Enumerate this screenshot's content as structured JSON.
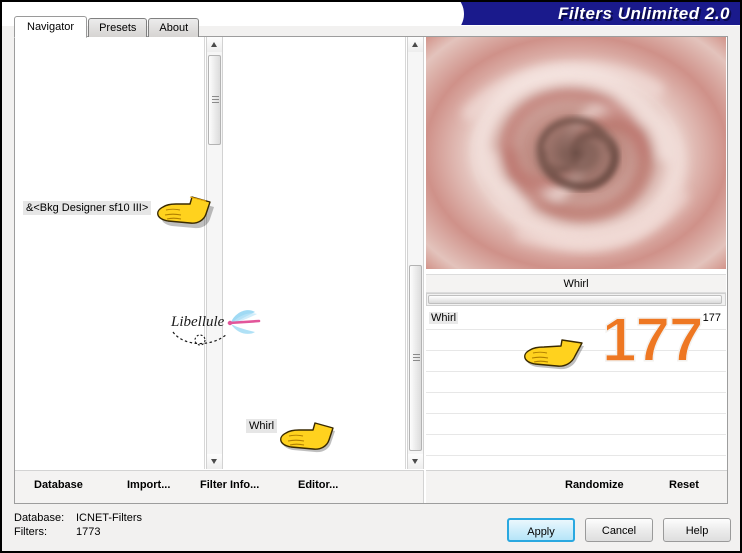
{
  "window": {
    "title": "Filters Unlimited 2.0"
  },
  "tabs": [
    {
      "label": "Navigator",
      "active": true
    },
    {
      "label": "Presets",
      "active": false
    },
    {
      "label": "About",
      "active": false
    }
  ],
  "navigator": {
    "category_list": [
      {
        "label": "&<Bkg Designer sf10 III>"
      }
    ],
    "filter_list": [
      {
        "label": "Whirl"
      }
    ]
  },
  "preview": {
    "alt": "whirl-spiral-preview",
    "colors": {
      "light": "#efd8d3",
      "mid": "#d39a90",
      "dark": "#a35b50",
      "deep": "#5b4038"
    }
  },
  "parameters": {
    "header": "Whirl",
    "rows": [
      {
        "name": "Whirl",
        "value": "177"
      },
      {
        "name": "",
        "value": ""
      },
      {
        "name": "",
        "value": ""
      },
      {
        "name": "",
        "value": ""
      },
      {
        "name": "",
        "value": ""
      },
      {
        "name": "",
        "value": ""
      },
      {
        "name": "",
        "value": ""
      }
    ]
  },
  "left_commands": [
    {
      "label": "Database",
      "accel": "D"
    },
    {
      "label": "Import...",
      "accel": "m"
    },
    {
      "label": "Filter Info...",
      "accel": "I"
    },
    {
      "label": "Editor...",
      "accel": "E"
    }
  ],
  "right_commands": [
    {
      "label": "Randomize"
    },
    {
      "label": "Reset"
    }
  ],
  "status": {
    "database_label": "Database:",
    "database_value": "ICNET-Filters",
    "filters_label": "Filters:",
    "filters_value": "1773"
  },
  "buttons": {
    "apply": "Apply",
    "cancel": "Cancel",
    "help": "Help"
  },
  "annotations": {
    "big_value": "177",
    "watermark": "Libellule",
    "hand_1": "pointing-hand-category",
    "hand_2": "pointing-hand-filter",
    "hand_3": "pointing-hand-parameter"
  },
  "accent_colors": {
    "titlebar": "#1a1a8c",
    "annotation_orange": "#ee7722",
    "apply_focus": "#2aa8e0",
    "hand_yellow": "#ffd21e"
  }
}
